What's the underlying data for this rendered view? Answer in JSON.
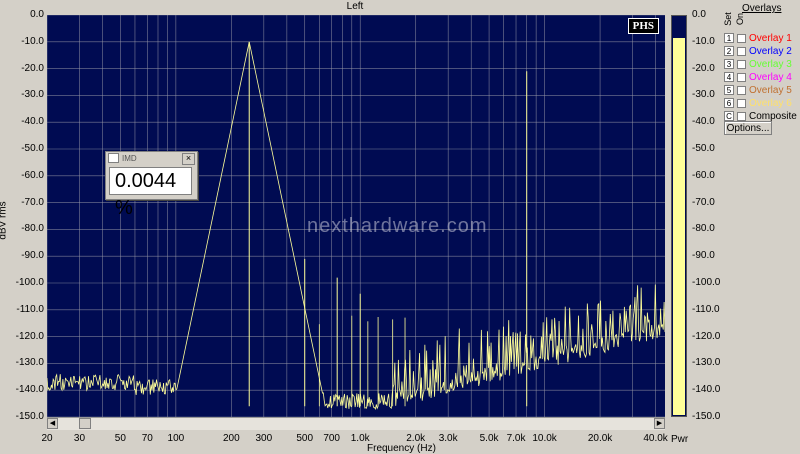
{
  "window": {
    "title": "Left"
  },
  "badge": "PHS",
  "watermark": "nexthardware.com",
  "imd_panel": {
    "title": "IMD",
    "close_icon": "×",
    "value": "0.0044 %"
  },
  "overlays": {
    "title": "Overlays",
    "header_set": "Set",
    "header_on": "On",
    "items": [
      {
        "num": "1",
        "label": "Overlay 1",
        "color": "#ff0000"
      },
      {
        "num": "2",
        "label": "Overlay 2",
        "color": "#0000ff"
      },
      {
        "num": "3",
        "label": "Overlay 3",
        "color": "#66ff33"
      },
      {
        "num": "4",
        "label": "Overlay 4",
        "color": "#ff00ff"
      },
      {
        "num": "5",
        "label": "Overlay 5",
        "color": "#c07030"
      },
      {
        "num": "6",
        "label": "Overlay 6",
        "color": "#ffe06a"
      },
      {
        "num": "C",
        "label": "Composite",
        "color": "#000000"
      }
    ],
    "options_label": "Options..."
  },
  "meter": {
    "label": "Pwr",
    "level_db": -8.5
  },
  "chart_data": {
    "type": "line",
    "xlabel": "Frequency (Hz)",
    "ylabel": "dBV rms",
    "xscale": "log",
    "xlim": [
      20,
      45000
    ],
    "ylim": [
      -150,
      0
    ],
    "grid": true,
    "background": "#000b52",
    "trace_color": "#ffff99",
    "x_ticks": [
      "20",
      "30",
      "50",
      "70",
      "100",
      "200",
      "300",
      "500",
      "700",
      "1.0k",
      "2.0k",
      "3.0k",
      "5.0k",
      "7.0k",
      "10.0k",
      "20.0k",
      "40.0k"
    ],
    "y_ticks": [
      "0.0",
      "-10.0",
      "-20.0",
      "-30.0",
      "-40.0",
      "-50.0",
      "-60.0",
      "-70.0",
      "-80.0",
      "-90.0",
      "-100.0",
      "-110.0",
      "-120.0",
      "-130.0",
      "-140.0",
      "-150.0"
    ],
    "meter_ticks": [
      "0.0",
      "-10.0",
      "-20.0",
      "-30.0",
      "-40.0",
      "-50.0",
      "-60.0",
      "-70.0",
      "-80.0",
      "-90.0",
      "-100.0",
      "-110.0",
      "-120.0",
      "-130.0",
      "-140.0",
      "-150.0"
    ],
    "peaks": [
      {
        "x": 250,
        "y": -10
      },
      {
        "x": 500,
        "y": -91
      },
      {
        "x": 750,
        "y": -98
      },
      {
        "x": 1000,
        "y": -104
      },
      {
        "x": 8000,
        "y": -21
      }
    ]
  }
}
